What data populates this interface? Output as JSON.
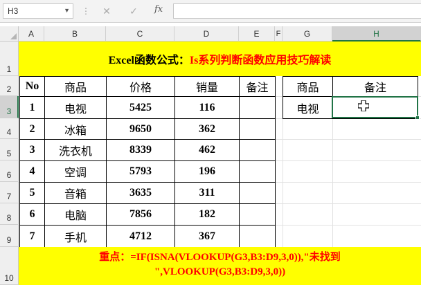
{
  "namebox": {
    "value": "H3"
  },
  "formula_bar": {
    "cancel_icon": "✕",
    "enter_icon": "✓",
    "fx_label": "fx",
    "value": ""
  },
  "columns": [
    "A",
    "B",
    "C",
    "D",
    "E",
    "F",
    "G",
    "H"
  ],
  "rows": [
    "1",
    "2",
    "3",
    "4",
    "5",
    "6",
    "7",
    "8",
    "9",
    "10"
  ],
  "title": {
    "part1": "Excel函数公式：",
    "part2": "Is系列判断函数应用技巧解读"
  },
  "table": {
    "headers": [
      "No",
      "商品",
      "价格",
      "销量",
      "备注"
    ],
    "rows": [
      [
        "1",
        "电视",
        "5425",
        "116",
        ""
      ],
      [
        "2",
        "冰箱",
        "9650",
        "362",
        ""
      ],
      [
        "3",
        "洗衣机",
        "8339",
        "462",
        ""
      ],
      [
        "4",
        "空调",
        "5793",
        "196",
        ""
      ],
      [
        "5",
        "音箱",
        "3635",
        "311",
        ""
      ],
      [
        "6",
        "电脑",
        "7856",
        "182",
        ""
      ],
      [
        "7",
        "手机",
        "4712",
        "367",
        ""
      ]
    ]
  },
  "lookup": {
    "headers": [
      "商品",
      "备注"
    ],
    "product": "电视",
    "remark": ""
  },
  "footer": {
    "label": "重点：",
    "line1": "=IF(ISNA(VLOOKUP(G3,B3:D9,3,0)),\"未找到",
    "line2": "\",VLOOKUP(G3,B3:D9,3,0))"
  },
  "colors": {
    "accent": "#217346",
    "highlight": "#ffff00",
    "red": "#ff0000"
  }
}
